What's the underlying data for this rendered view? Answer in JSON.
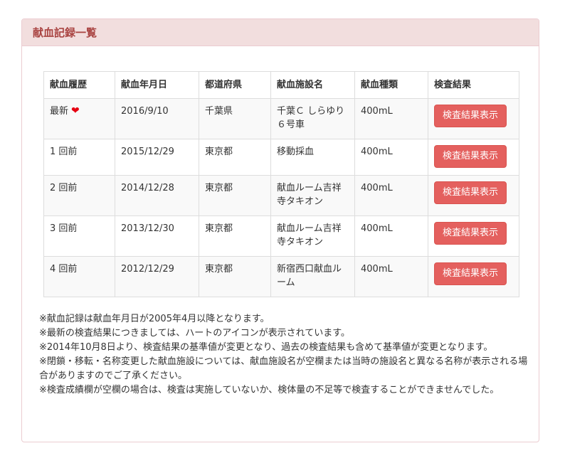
{
  "panel": {
    "title": "献血記録一覧"
  },
  "table": {
    "headers": [
      "献血履歴",
      "献血年月日",
      "都道府県",
      "献血施設名",
      "献血種類",
      "検査結果"
    ],
    "rows": [
      {
        "history": "最新",
        "date": "2016/9/10",
        "prefecture": "千葉県",
        "facility": "千葉Ｃ しらゆり６号車",
        "type": "400mL",
        "button": "検査結果表示",
        "latest": true
      },
      {
        "history": "1 回前",
        "date": "2015/12/29",
        "prefecture": "東京都",
        "facility": "移動採血",
        "type": "400mL",
        "button": "検査結果表示"
      },
      {
        "history": "2 回前",
        "date": "2014/12/28",
        "prefecture": "東京都",
        "facility": "献血ルーム吉祥寺タキオン",
        "type": "400mL",
        "button": "検査結果表示"
      },
      {
        "history": "3 回前",
        "date": "2013/12/30",
        "prefecture": "東京都",
        "facility": "献血ルーム吉祥寺タキオン",
        "type": "400mL",
        "button": "検査結果表示"
      },
      {
        "history": "4 回前",
        "date": "2012/12/29",
        "prefecture": "東京都",
        "facility": "新宿西口献血ルーム",
        "type": "400mL",
        "button": "検査結果表示"
      }
    ]
  },
  "notes": [
    "※献血記録は献血年月日が2005年4月以降となります。",
    "※最新の検査結果につきましては、ハートのアイコンが表示されています。",
    "※2014年10月8日より、検査結果の基準値が変更となり、過去の検査結果も含めて基準値が変更となります。",
    "※閉鎖・移転・名称変更した献血施設については、献血施設名が空欄または当時の施設名と異なる名称が表示される場合がありますのでご了承ください。",
    "※検査成績欄が空欄の場合は、検査は実施していないか、検体量の不足等で検査することができませんでした。"
  ],
  "colors": {
    "heading_bg": "#f2dede",
    "heading_text": "#a94442",
    "button_bg": "#e4605e",
    "heart": "#e60012"
  }
}
